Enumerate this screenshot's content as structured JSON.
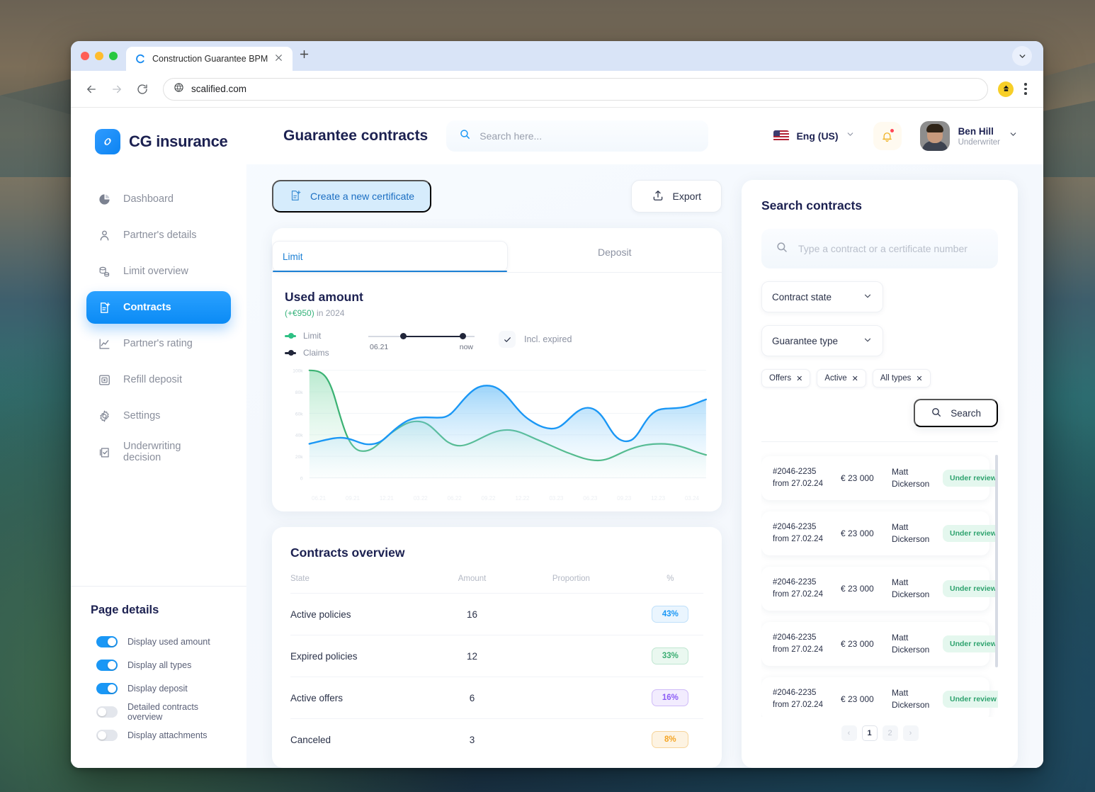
{
  "browser": {
    "tab_title": "Construction Guarantee BPM",
    "url": "scalified.com",
    "new_tab_label": "+"
  },
  "brand": {
    "name": "CG insurance"
  },
  "sidebar": {
    "items": [
      {
        "label": "Dashboard",
        "icon": "pie-chart-icon",
        "active": false
      },
      {
        "label": "Partner's details",
        "icon": "user-icon",
        "active": false
      },
      {
        "label": "Limit overview",
        "icon": "coins-icon",
        "active": false
      },
      {
        "label": "Contracts",
        "icon": "document-plus-icon",
        "active": true
      },
      {
        "label": "Partner's rating",
        "icon": "line-chart-icon",
        "active": false
      },
      {
        "label": "Refill deposit",
        "icon": "safe-icon",
        "active": false
      },
      {
        "label": "Settings",
        "icon": "gear-icon",
        "active": false
      },
      {
        "label": "Underwriting decision",
        "icon": "checklist-icon",
        "active": false
      }
    ],
    "page_details": {
      "title": "Page details",
      "toggles": [
        {
          "label": "Display used amount",
          "on": true
        },
        {
          "label": "Display all types",
          "on": true
        },
        {
          "label": "Display deposit",
          "on": true
        },
        {
          "label": "Detailed contracts overview",
          "on": false
        },
        {
          "label": "Display attachments",
          "on": false
        }
      ]
    }
  },
  "header": {
    "page_title": "Guarantee contracts",
    "search_placeholder": "Search here...",
    "language": "Eng (US)",
    "user": {
      "name": "Ben Hill",
      "role": "Underwriter"
    }
  },
  "toolbar": {
    "create_label": "Create a new certificate",
    "export_label": "Export"
  },
  "chart_card": {
    "tabs": [
      {
        "label": "Limit",
        "selected": true
      },
      {
        "label": "Deposit",
        "selected": false
      }
    ],
    "title": "Used amount",
    "delta": "(+€950)",
    "period": "in 2024",
    "legend": [
      {
        "label": "Limit",
        "color": "#2fc084"
      },
      {
        "label": "Claims",
        "color": "#21263a"
      }
    ],
    "slider": {
      "from": "06.21",
      "to": "now"
    },
    "incl_expired": {
      "label": "Incl. expired",
      "checked": true
    }
  },
  "chart_data": {
    "type": "area",
    "title": "Used amount",
    "subtitle": "(+€950) in 2024",
    "xlabel": "",
    "ylabel": "",
    "ylim": [
      0,
      100000
    ],
    "yticks": [
      0,
      20000,
      40000,
      60000,
      80000,
      100000
    ],
    "ytick_labels": [
      "0",
      "20k",
      "40k",
      "60k",
      "80k",
      "100k"
    ],
    "x": [
      "06.21",
      "09.21",
      "12.21",
      "03.22",
      "06.22",
      "09.22",
      "12.22",
      "03.23",
      "06.23",
      "09.23",
      "12.23",
      "03.24"
    ],
    "grid": true,
    "legend_position": "top-left",
    "series": [
      {
        "name": "Limit",
        "color": "#2fc084",
        "values": [
          100000,
          97000,
          30000,
          27000,
          44000,
          52000,
          40000,
          46000,
          45000,
          34000,
          22000,
          30000,
          35000
        ]
      },
      {
        "name": "Claims",
        "color": "#1a97f5",
        "values": [
          36000,
          40000,
          38000,
          34000,
          56000,
          58000,
          59000,
          74000,
          68000,
          52000,
          57000,
          42000,
          36000,
          62000,
          66000
        ]
      }
    ]
  },
  "overview": {
    "title": "Contracts overview",
    "columns": [
      "State",
      "Amount",
      "Proportion",
      "%"
    ],
    "rows": [
      {
        "state": "Active policies",
        "amount": "16",
        "percent": "43%",
        "fill": 43,
        "color": "#1a97f5",
        "track": "#d9ecfd",
        "pill_bg": "#eaf5fe",
        "pill_border": "#bfe0fa"
      },
      {
        "state": "Expired policies",
        "amount": "12",
        "percent": "33%",
        "fill": 33,
        "color": "#3aae72",
        "track": "#d9f0e4",
        "pill_bg": "#eaf8f0",
        "pill_border": "#bfe6d1"
      },
      {
        "state": "Active offers",
        "amount": "6",
        "percent": "16%",
        "fill": 16,
        "color": "#8b5cf6",
        "track": "#ddd0fa",
        "pill_bg": "#f2ecfe",
        "pill_border": "#cfbbf8"
      },
      {
        "state": "Canceled",
        "amount": "3",
        "percent": "8%",
        "fill": 8,
        "color": "#f5a524",
        "track": "#fbe2bb",
        "pill_bg": "#fdf3e2",
        "pill_border": "#f6d49a"
      }
    ]
  },
  "search_panel": {
    "title": "Search contracts",
    "input_placeholder": "Type a contract or a certificate number",
    "selects": [
      {
        "label": "Contract state"
      },
      {
        "label": "Guarantee type"
      }
    ],
    "chips": [
      {
        "label": "Offers"
      },
      {
        "label": "Active"
      },
      {
        "label": "All types"
      }
    ],
    "search_button": "Search",
    "contracts": [
      {
        "id": "#2046-2235",
        "from": "from 27.02.24",
        "amount": "€ 23 000",
        "name_first": "Matt",
        "name_last": "Dickerson",
        "status": "Under review"
      },
      {
        "id": "#2046-2235",
        "from": "from 27.02.24",
        "amount": "€ 23 000",
        "name_first": "Matt",
        "name_last": "Dickerson",
        "status": "Under review"
      },
      {
        "id": "#2046-2235",
        "from": "from 27.02.24",
        "amount": "€ 23 000",
        "name_first": "Matt",
        "name_last": "Dickerson",
        "status": "Under review"
      },
      {
        "id": "#2046-2235",
        "from": "from 27.02.24",
        "amount": "€ 23 000",
        "name_first": "Matt",
        "name_last": "Dickerson",
        "status": "Under review"
      },
      {
        "id": "#2046-2235",
        "from": "from 27.02.24",
        "amount": "€ 23 000",
        "name_first": "Matt",
        "name_last": "Dickerson",
        "status": "Under review"
      }
    ],
    "pagination": {
      "prev": "‹",
      "pages": [
        "1",
        "2"
      ],
      "current": "1",
      "next": "›"
    }
  }
}
